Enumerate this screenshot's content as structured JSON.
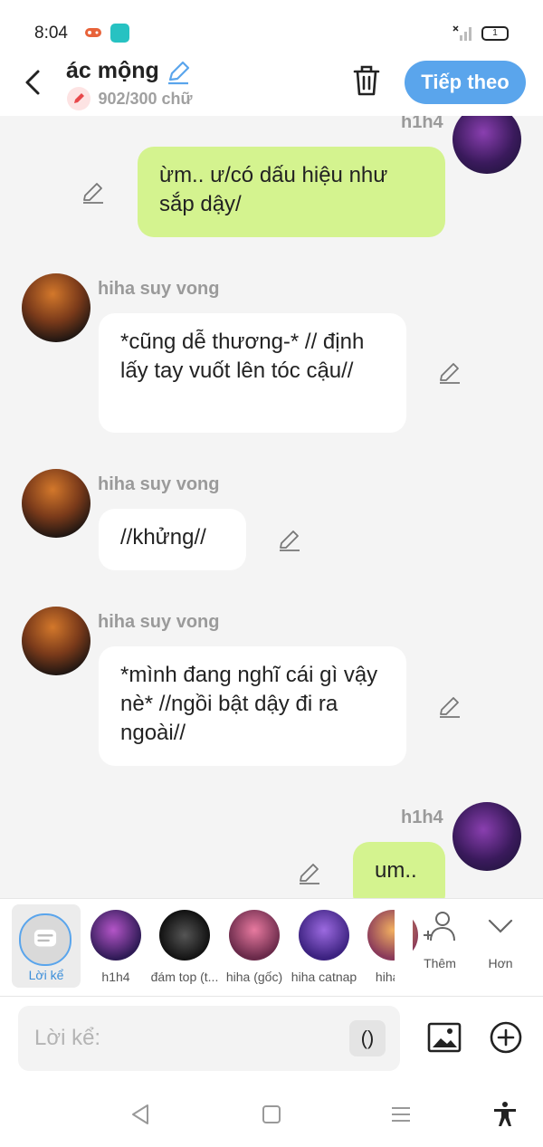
{
  "status_bar": {
    "time": "8:04",
    "battery": "1"
  },
  "header": {
    "title": "ác mộng",
    "char_count": "902/300 chữ",
    "next_label": "Tiếp theo"
  },
  "messages": [
    {
      "sender": "h1h4",
      "side": "me",
      "text": "ừm.. ư/có dấu hiệu như sắp dậy/"
    },
    {
      "sender": "hiha suy vong",
      "side": "them",
      "text": "*cũng dễ thương-* // định lấy tay vuốt lên tóc cậu//"
    },
    {
      "sender": "hiha suy vong",
      "side": "them",
      "text": "//khửng//"
    },
    {
      "sender": "hiha suy vong",
      "side": "them",
      "text": "*mình đang nghĩ cái gì vậy nè* //ngồi bật dậy đi ra ngoài//"
    },
    {
      "sender": "h1h4",
      "side": "me",
      "text": "um.."
    }
  ],
  "characters": [
    {
      "name": "Lời kể",
      "selected": true
    },
    {
      "name": "h1h4"
    },
    {
      "name": "đám top (t..."
    },
    {
      "name": "hiha (gốc)"
    },
    {
      "name": "hiha catnap"
    },
    {
      "name": "hiha a"
    }
  ],
  "char_actions": {
    "add_label": "Thêm",
    "more_label": "Hơn"
  },
  "input": {
    "placeholder": "Lời kể:",
    "paren_label": "()"
  },
  "colors": {
    "accent": "#5aa5ec",
    "me_bubble": "#d4f38f",
    "them_bubble": "#ffffff"
  }
}
